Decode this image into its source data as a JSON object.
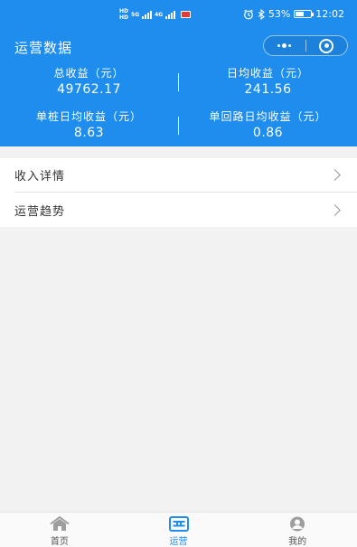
{
  "status_bar": {
    "hd_top": "HD",
    "hd_bottom": "HD",
    "net1": "5G",
    "net2": "4G",
    "battery": "53%",
    "time": "12:02"
  },
  "header": {
    "title": "运营数据"
  },
  "stats": {
    "total_income": {
      "label": "总收益（元）",
      "value": "49762.17"
    },
    "daily_income": {
      "label": "日均收益（元）",
      "value": "241.56"
    },
    "per_pile_daily": {
      "label": "单桩日均收益（元）",
      "value": "8.63"
    },
    "per_circuit_daily": {
      "label": "单回路日均收益（元）",
      "value": "0.86"
    }
  },
  "menu": [
    {
      "label": "收入详情"
    },
    {
      "label": "运营趋势"
    }
  ],
  "tabbar": [
    {
      "label": "首页",
      "icon": "home-icon",
      "active": false
    },
    {
      "label": "运营",
      "icon": "operations-icon",
      "active": true
    },
    {
      "label": "我的",
      "icon": "profile-icon",
      "active": false
    }
  ],
  "colors": {
    "primary": "#1e8ded",
    "background": "#f2f2f2",
    "tab_inactive": "#9e9e9e"
  }
}
